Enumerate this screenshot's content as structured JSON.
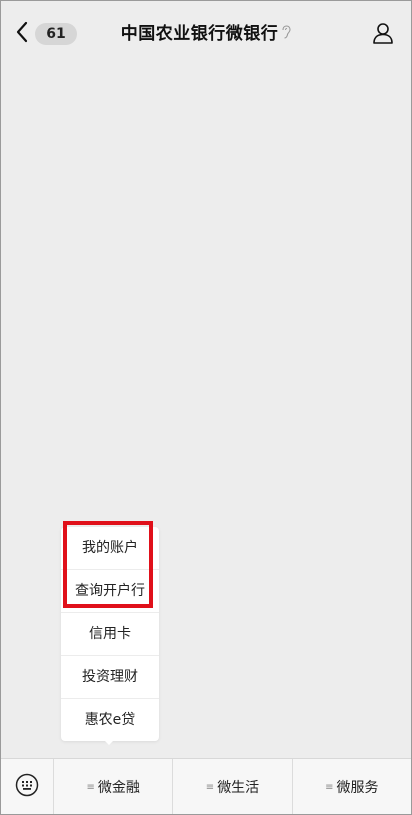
{
  "header": {
    "back_count": "61",
    "title": "中国农业银行微银行"
  },
  "popup": {
    "items": [
      {
        "label": "我的账户"
      },
      {
        "label": "查询开户行"
      },
      {
        "label": "信用卡"
      },
      {
        "label": "投资理财"
      },
      {
        "label": "惠农e贷"
      }
    ]
  },
  "bottom_menu": {
    "tabs": [
      {
        "label": "微金融"
      },
      {
        "label": "微生活"
      },
      {
        "label": "微服务"
      }
    ]
  },
  "icons": {
    "back": "chevron-left-icon",
    "ear": "ear-icon",
    "profile": "person-icon",
    "keyboard": "keyboard-icon",
    "menu": "hamburger-icon"
  },
  "colors": {
    "background": "#ededed",
    "highlight": "#e0101a",
    "badge": "#d6d6d6"
  }
}
